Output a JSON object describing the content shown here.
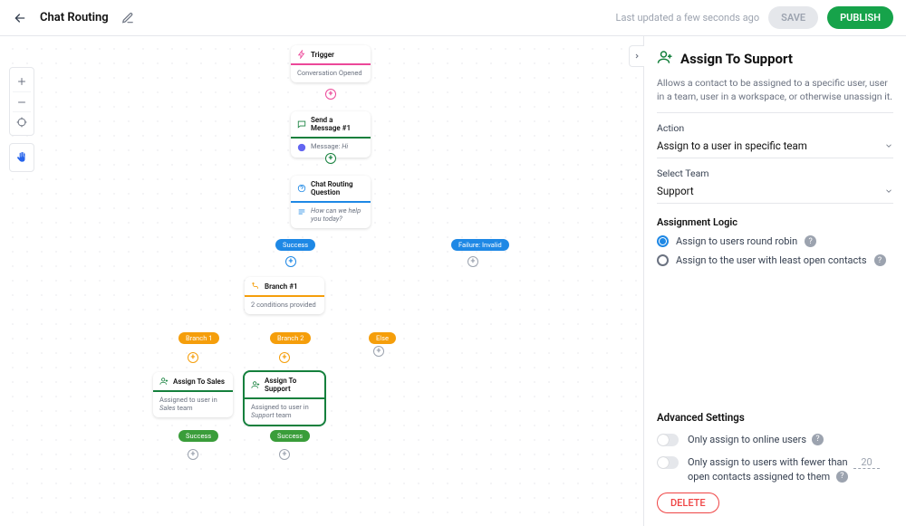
{
  "header": {
    "title": "Chat Routing",
    "last_updated": "Last updated a few seconds ago",
    "save_label": "SAVE",
    "publish_label": "PUBLISH"
  },
  "nodes": {
    "trigger": {
      "title": "Trigger",
      "body": "Conversation Opened",
      "accent": "#ec4899"
    },
    "send_msg": {
      "title": "Send a Message #1",
      "body_prefix": "Message: ",
      "body_value": "Hi",
      "accent": "#15803d"
    },
    "question": {
      "title": "Chat Routing Question",
      "body": "How can we help you today?",
      "accent": "#1e88e5"
    },
    "branch": {
      "title": "Branch #1",
      "body": "2 conditions provided",
      "accent": "#f59e0b"
    },
    "assign_sales": {
      "title": "Assign To Sales",
      "body_prefix": "Assigned to user in ",
      "body_team": "Sales",
      "body_suffix": " team",
      "accent": "#15803d"
    },
    "assign_support": {
      "title": "Assign To Support",
      "body_prefix": "Assigned to user in ",
      "body_team": "Support",
      "body_suffix": " team",
      "accent": "#15803d"
    }
  },
  "pills": {
    "success1": "Success",
    "failure1": "Failure: Invalid",
    "branch1": "Branch 1",
    "branch2": "Branch 2",
    "else": "Else",
    "success2": "Success",
    "success3": "Success"
  },
  "panel": {
    "title": "Assign To Support",
    "description": "Allows a contact to be assigned to a specific user, user in a team, user in a workspace, or otherwise unassign it.",
    "action_label": "Action",
    "action_value": "Assign to a user in specific team",
    "team_label": "Select Team",
    "team_value": "Support",
    "logic_head": "Assignment Logic",
    "radio1": "Assign to users round robin",
    "radio2": "Assign to the user with least open contacts",
    "advanced_head": "Advanced Settings",
    "toggle1": "Only assign to online users",
    "toggle2_pre": "Only assign to users with fewer than",
    "toggle2_val": "20",
    "toggle2_post": "open contacts assigned to them",
    "delete_label": "DELETE"
  }
}
